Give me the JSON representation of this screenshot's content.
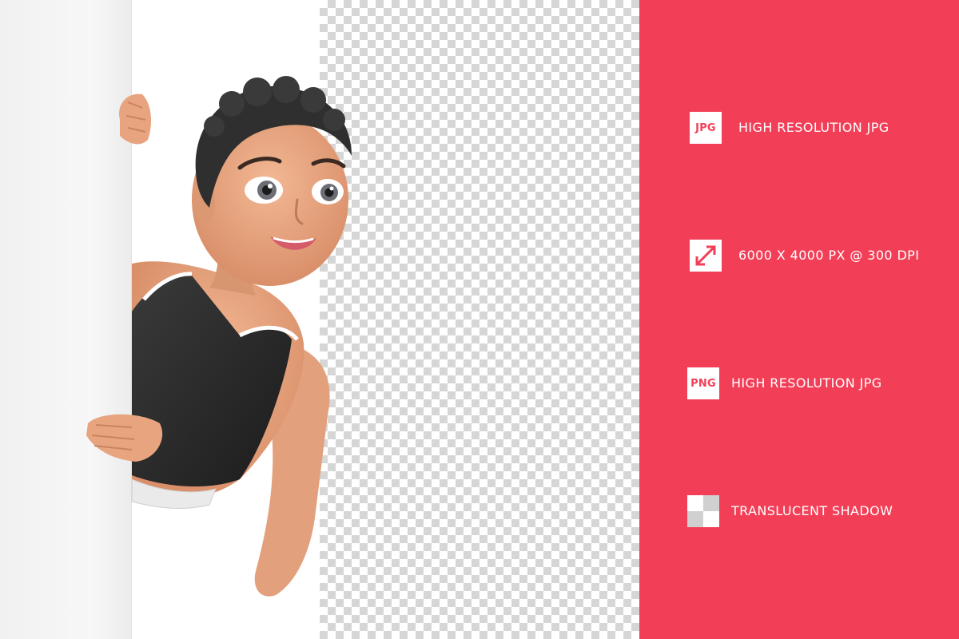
{
  "colors": {
    "accent": "#f23f57",
    "icon_bg": "#ffffff",
    "checker": "#d6d6d6"
  },
  "preview": {
    "background_left": "white",
    "background_right": "transparency-checkerboard",
    "subject": "cartoon-woman-peeking-behind-board"
  },
  "features": [
    {
      "icon": "jpg-badge-icon",
      "icon_text": "JPG",
      "label": "HIGH RESOLUTION JPG"
    },
    {
      "icon": "resize-arrow-icon",
      "icon_text": "",
      "label": "6000 X 4000 PX @ 300 DPI"
    },
    {
      "icon": "png-badge-icon",
      "icon_text": "PNG",
      "label": "HIGH RESOLUTION JPG"
    },
    {
      "icon": "checker-icon",
      "icon_text": "",
      "label": "TRANSLUCENT SHADOW"
    }
  ]
}
